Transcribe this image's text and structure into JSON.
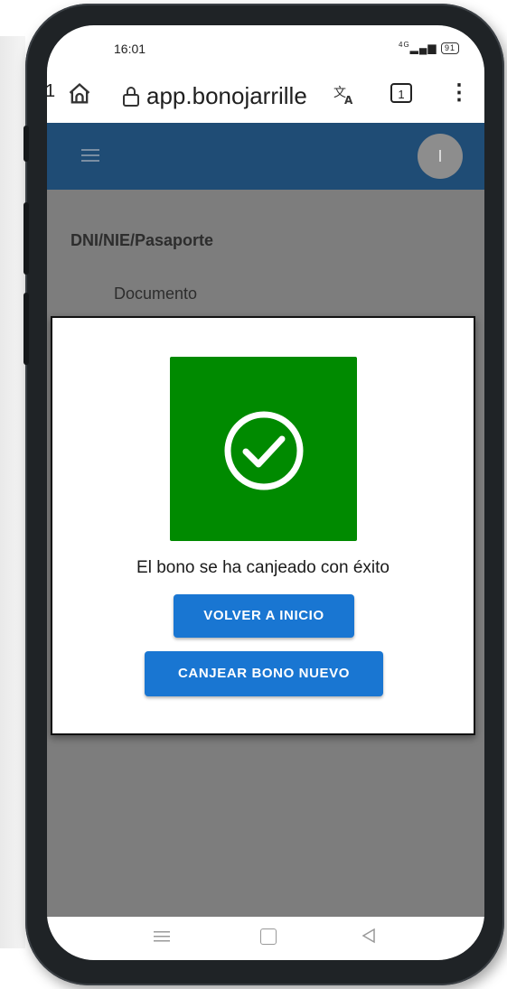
{
  "status_bar": {
    "time": "16:01",
    "signal": "4G",
    "battery": "91"
  },
  "browser": {
    "leading_char": "1",
    "url": "app.bonojarrille",
    "tab_count": "1",
    "menu_glyph": "⋮"
  },
  "app_bar": {
    "avatar_initial": "I",
    "color": "#1f4c75"
  },
  "form": {
    "field_label": "DNI/NIE/Pasaporte",
    "field_placeholder": "Documento"
  },
  "dialog": {
    "success_color": "#008a00",
    "message": "El bono se ha canjeado con éxito",
    "primary_button": "VOLVER A INICIO",
    "secondary_button": "CANJEAR BONO NUEVO",
    "button_color": "#1976d2"
  },
  "icons": [
    "home-icon",
    "lock-icon",
    "translate-icon",
    "tabs-icon",
    "more-vert-icon",
    "hamburger-menu-icon",
    "check-circle-icon",
    "nav-recents-icon",
    "nav-home-icon",
    "nav-back-icon"
  ]
}
